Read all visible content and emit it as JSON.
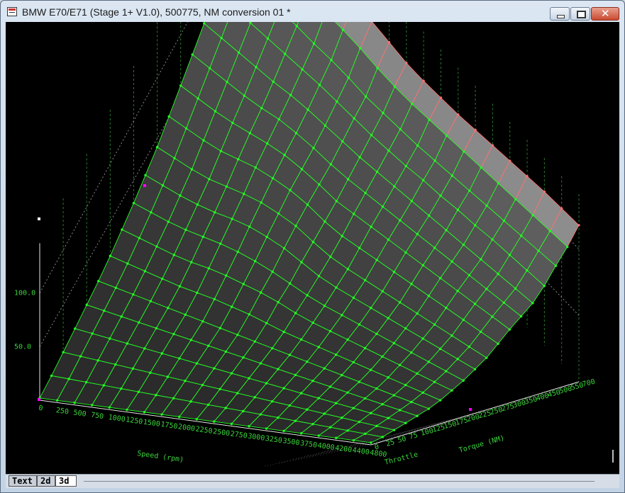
{
  "window": {
    "title": "BMW E70/E71 (Stage 1+ V1.0), 500775, NM conversion 01 *"
  },
  "icons": {
    "app": "app-icon",
    "minimize": "minimize-icon",
    "maximize": "maximize-icon",
    "close": "close-icon"
  },
  "colors": {
    "background": "#000000",
    "mesh_line": "#22ff22",
    "mesh_point": "#22ff22",
    "upper_mesh_line": "#ff7070",
    "label": "#3bd43b",
    "marker": "#ff00ff"
  },
  "chart_data": {
    "type": "surface-3d",
    "x_axis": {
      "label": "Speed (rpm)",
      "ticks": [
        "0",
        "250",
        "500",
        "750",
        "1000",
        "1250",
        "1500",
        "1750",
        "2000",
        "2250",
        "2500",
        "2750",
        "3000",
        "3250",
        "3500",
        "3750",
        "4000",
        "4200",
        "4400",
        "4800"
      ]
    },
    "y_axis": {
      "label": "Torque (NM)",
      "ticks": [
        "0",
        "25",
        "50",
        "75",
        "100",
        "125",
        "150",
        "175",
        "200",
        "225",
        "250",
        "275",
        "300",
        "350",
        "400",
        "450",
        "500",
        "550",
        "700"
      ]
    },
    "z_axis": {
      "ticks": [
        "50.0",
        "100.0"
      ],
      "range": [
        0,
        120
      ]
    },
    "ambiguous_labels": [
      "Throttle"
    ],
    "surface_points": [
      [
        2,
        2,
        2,
        2,
        2,
        2,
        2,
        2,
        2,
        2,
        2,
        2,
        2,
        2,
        2,
        2,
        2,
        2,
        2,
        2
      ],
      [
        4,
        4,
        4,
        4,
        4,
        4,
        4,
        4,
        4,
        4,
        4,
        4,
        4,
        4,
        4,
        4,
        4,
        4,
        4,
        4
      ],
      [
        7,
        7,
        7,
        7,
        7,
        7,
        7,
        7,
        7,
        7,
        7,
        7,
        7,
        7,
        7,
        7,
        7,
        7,
        7,
        7
      ],
      [
        10,
        10,
        10,
        10,
        10,
        10,
        10,
        10,
        10,
        10,
        10,
        10,
        10,
        10,
        10,
        10,
        10,
        10,
        10,
        10
      ],
      [
        13,
        13,
        13,
        13,
        13,
        13,
        13,
        13,
        13,
        13,
        13,
        13,
        13,
        13,
        13,
        13,
        13,
        13,
        13,
        13
      ],
      [
        16,
        16,
        16,
        16,
        16,
        16,
        16,
        16,
        16,
        16,
        16,
        16,
        16,
        16,
        16,
        16,
        16,
        16,
        16,
        16
      ],
      [
        20,
        20,
        20,
        20,
        20,
        21,
        22,
        22,
        22,
        21,
        20,
        20,
        20,
        20,
        20,
        20,
        20,
        20,
        20,
        20
      ],
      [
        25,
        25,
        25,
        25,
        26,
        28,
        29,
        29,
        29,
        28,
        26,
        25,
        25,
        25,
        25,
        25,
        25,
        25,
        25,
        25
      ],
      [
        30,
        30,
        30,
        31,
        33,
        35,
        36,
        36,
        35,
        33,
        31,
        30,
        30,
        30,
        30,
        30,
        30,
        30,
        30,
        30
      ],
      [
        36,
        36,
        36,
        37,
        39,
        42,
        44,
        44,
        43,
        40,
        37,
        36,
        36,
        36,
        36,
        36,
        36,
        36,
        36,
        36
      ],
      [
        42,
        42,
        42,
        43,
        46,
        49,
        51,
        51,
        50,
        46,
        43,
        42,
        42,
        42,
        42,
        42,
        42,
        42,
        42,
        42
      ],
      [
        50,
        50,
        50,
        51,
        54,
        57,
        58,
        58,
        56,
        52,
        50,
        50,
        50,
        50,
        50,
        50,
        50,
        50,
        50,
        50
      ],
      [
        58,
        58,
        58,
        59,
        61,
        63,
        64,
        63,
        61,
        58,
        58,
        58,
        58,
        58,
        58,
        58,
        58,
        58,
        58,
        58
      ],
      [
        66,
        66,
        66,
        66,
        67,
        69,
        69,
        68,
        66,
        65,
        65,
        65,
        65,
        65,
        65,
        65,
        65,
        65,
        65,
        65
      ],
      [
        74,
        74,
        74,
        74,
        74,
        75,
        75,
        74,
        73,
        72,
        72,
        72,
        72,
        72,
        72,
        72,
        72,
        72,
        72,
        72
      ],
      [
        82,
        82,
        82,
        82,
        82,
        82,
        82,
        81,
        80,
        79,
        79,
        79,
        80,
        80,
        81,
        81,
        82,
        82,
        82,
        82
      ],
      [
        90,
        90,
        90,
        90,
        90,
        89,
        89,
        88,
        86,
        86,
        86,
        86,
        87,
        88,
        89,
        90,
        91,
        92,
        93,
        94
      ],
      [
        100,
        100,
        100,
        100,
        100,
        100,
        100,
        99,
        97,
        96,
        96,
        97,
        98,
        99,
        100,
        101,
        102,
        103,
        104,
        105
      ],
      [
        115,
        115,
        115,
        115,
        114,
        112,
        110,
        108,
        106,
        104,
        104,
        105,
        106,
        108,
        110,
        112,
        114,
        116,
        117,
        118
      ]
    ],
    "grid": true,
    "highlighted_rows": [
      17,
      18
    ]
  },
  "tabs": [
    {
      "label": "Text"
    },
    {
      "label": "2d"
    },
    {
      "label": "3d"
    }
  ]
}
